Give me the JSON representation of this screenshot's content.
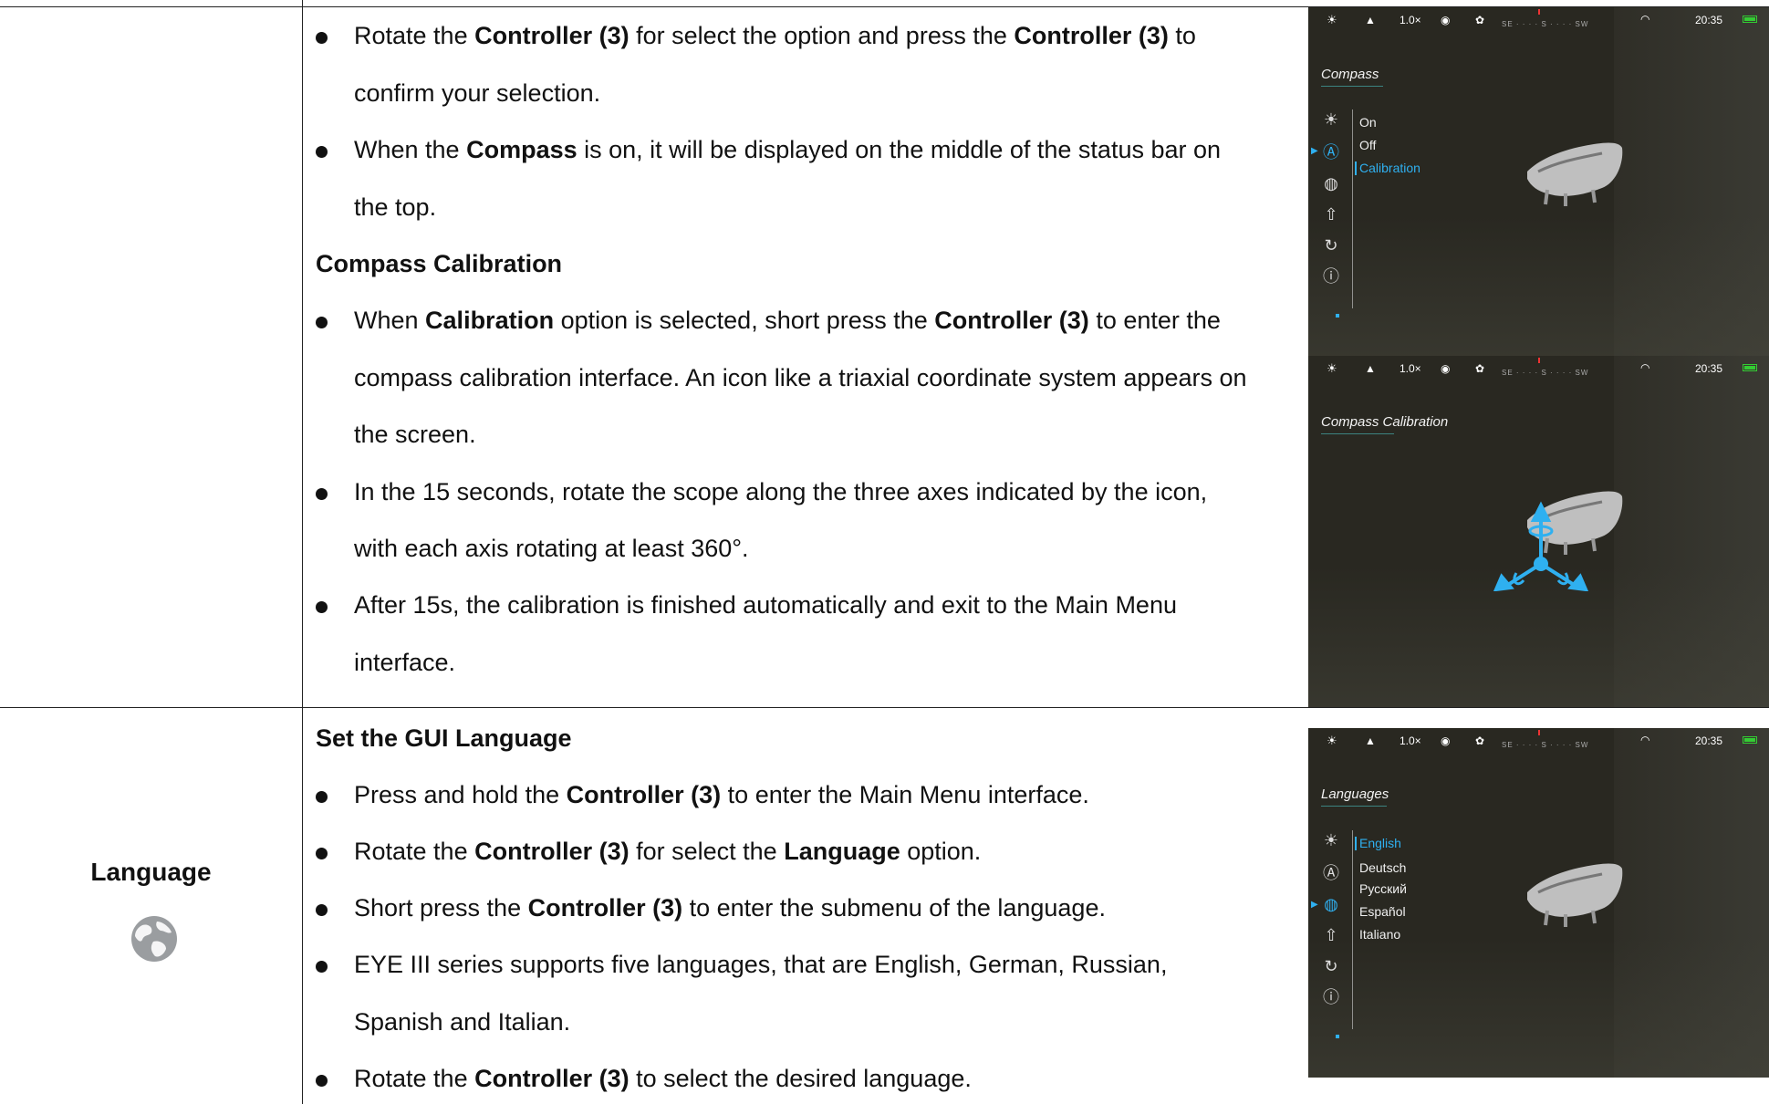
{
  "section_compass": {
    "bullets": [
      [
        "Rotate the ",
        {
          "b": "Controller (3)"
        },
        " for select the option and press the ",
        {
          "b": "Controller (3)"
        },
        " to"
      ],
      [
        "confirm your selection."
      ],
      [
        "When the ",
        {
          "b": "Compass"
        },
        " is on, it will be displayed on the middle of the status bar on"
      ],
      [
        "the top."
      ]
    ],
    "calibration_heading": "Compass Calibration",
    "calibration_lines": [
      [
        "When ",
        {
          "b": "Calibration"
        },
        " option is selected, short press the ",
        {
          "b": "Controller (3)"
        },
        " to enter the"
      ],
      [
        "compass calibration interface. An icon like a triaxial coordinate system appears on"
      ],
      [
        "the screen."
      ],
      [
        "In the 15 seconds, rotate the scope along the three axes indicated by the icon,"
      ],
      [
        "with each axis rotating at least 360°."
      ],
      [
        "After 15s, the calibration is finished automatically and exit to the Main Menu"
      ],
      [
        "interface."
      ]
    ]
  },
  "section_language": {
    "label": "Language",
    "icon": "globe-icon",
    "heading": "Set the GUI Language",
    "lines": [
      [
        "Press and hold the ",
        {
          "b": "Controller (3)"
        },
        " to enter the Main Menu interface."
      ],
      [
        "Rotate the ",
        {
          "b": "Controller (3)"
        },
        " for select the ",
        {
          "b": "Language"
        },
        " option."
      ],
      [
        "Short press the ",
        {
          "b": "Controller (3)"
        },
        " to enter the submenu of the language."
      ],
      [
        "EYE III series supports five languages, that are English, German, Russian,"
      ],
      [
        "Spanish and Italian."
      ],
      [
        "Rotate the ",
        {
          "b": "Controller (3)"
        },
        " to select the desired language."
      ]
    ]
  },
  "status_bar": {
    "zoom": "1.0×",
    "compass_scale": "SE · · · · S · · · · SW",
    "time": "20:35"
  },
  "screen1": {
    "title": "Compass",
    "options": [
      "On",
      "Off",
      "Calibration"
    ],
    "active_option": "Calibration"
  },
  "screen2": {
    "title": "Compass Calibration"
  },
  "screen3": {
    "title": "Languages",
    "options": [
      "English",
      "Deutsch",
      "Русский",
      "Español",
      "Italiano"
    ],
    "active_option": "English"
  },
  "colors": {
    "accent": "#2fb0f0",
    "screen_bg": "#292821"
  }
}
